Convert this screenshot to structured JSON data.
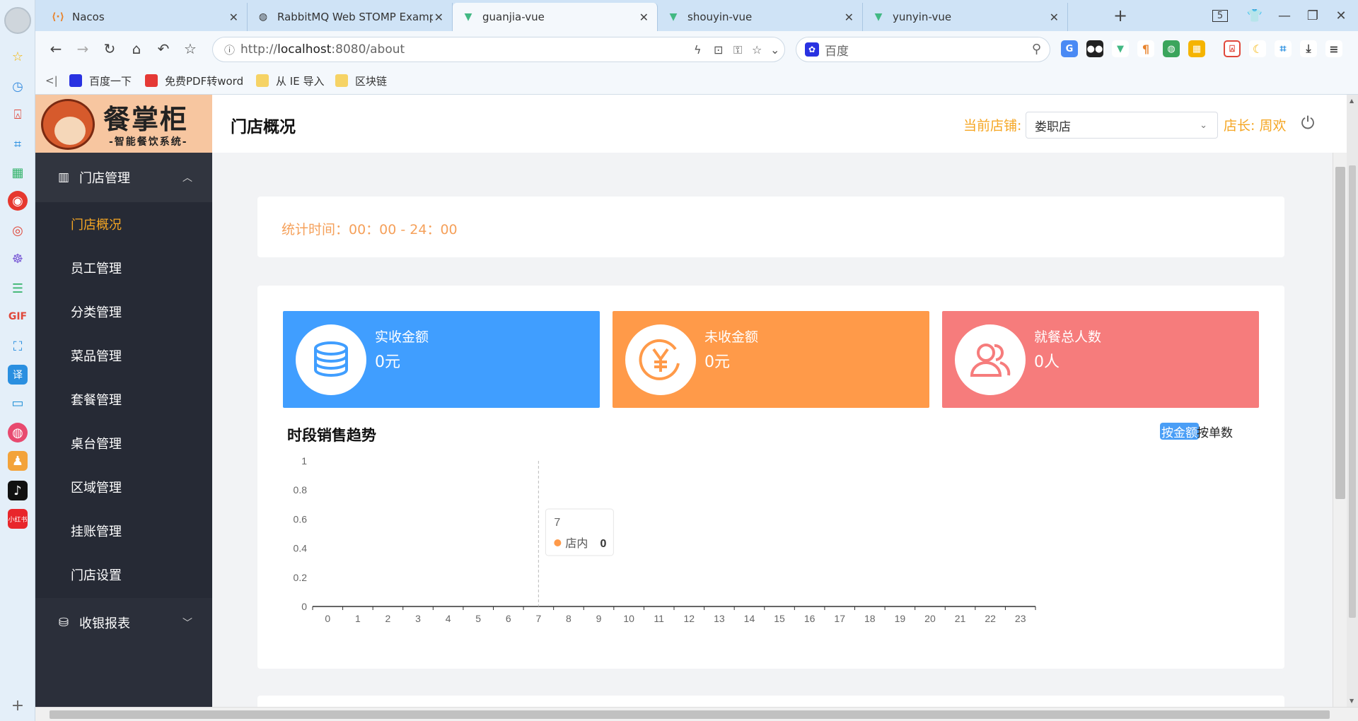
{
  "browser": {
    "tabs": [
      {
        "title": "Nacos",
        "favicon": "nacos-icon",
        "color": "#e8832c"
      },
      {
        "title": "RabbitMQ Web STOMP Examp",
        "favicon": "globe-icon",
        "color": "#333333"
      },
      {
        "title": "guanjia-vue",
        "favicon": "vue-icon",
        "color": "#42b883",
        "active": true
      },
      {
        "title": "shouyin-vue",
        "favicon": "vue-icon",
        "color": "#42b883"
      },
      {
        "title": "yunyin-vue",
        "favicon": "vue-icon",
        "color": "#42b883"
      }
    ],
    "tab_count": "5",
    "url_prefix": "http://",
    "url_host": "localhost",
    "url_rest": ":8080/about",
    "search_placeholder": "百度",
    "bookmarks": [
      {
        "label": "百度一下",
        "color": "#2932e1"
      },
      {
        "label": "免费PDF转word",
        "color": "#e53935"
      },
      {
        "label": "从 IE 导入",
        "color": "#f6d365"
      },
      {
        "label": "区块链",
        "color": "#f6d365"
      }
    ]
  },
  "app": {
    "logo": {
      "brand": "餐掌柜",
      "slogan": "-智能餐饮系统-"
    },
    "menu": {
      "group1": "门店管理",
      "items": [
        "门店概况",
        "员工管理",
        "分类管理",
        "菜品管理",
        "套餐管理",
        "桌台管理",
        "区域管理",
        "挂账管理",
        "门店设置"
      ],
      "active_index": 0,
      "group2": "收银报表"
    },
    "header": {
      "title": "门店概况",
      "store_label": "当前店铺:",
      "store_value": "娄职店",
      "manager": "店长: 周欢"
    },
    "stat_time": "统计时间：00：00 - 24：00",
    "metrics": [
      {
        "label": "实收金额",
        "value": "0元",
        "icon": "coins-stack-icon",
        "color": "#409eff"
      },
      {
        "label": "未收金额",
        "value": "0元",
        "icon": "yen-circle-icon",
        "color": "#ff9a49"
      },
      {
        "label": "就餐总人数",
        "value": "0人",
        "icon": "users-icon",
        "color": "#f67c7c"
      }
    ],
    "trend": {
      "title": "时段销售趋势",
      "btn_amount": "按金额",
      "btn_count": "按单数"
    }
  },
  "chart_data": {
    "type": "line",
    "categories": [
      "0",
      "1",
      "2",
      "3",
      "4",
      "5",
      "6",
      "7",
      "8",
      "9",
      "10",
      "11",
      "12",
      "13",
      "14",
      "15",
      "16",
      "17",
      "18",
      "19",
      "20",
      "21",
      "22",
      "23"
    ],
    "series": [
      {
        "name": "店内",
        "values": [
          0,
          0,
          0,
          0,
          0,
          0,
          0,
          0,
          0,
          0,
          0,
          0,
          0,
          0,
          0,
          0,
          0,
          0,
          0,
          0,
          0,
          0,
          0,
          0
        ],
        "color": "#ff9a49"
      }
    ],
    "ylim": [
      0,
      1
    ],
    "yticks": [
      "0",
      "0.2",
      "0.4",
      "0.6",
      "0.8",
      "1"
    ],
    "tooltip": {
      "category": "7",
      "series": "店内",
      "value": "0"
    }
  }
}
